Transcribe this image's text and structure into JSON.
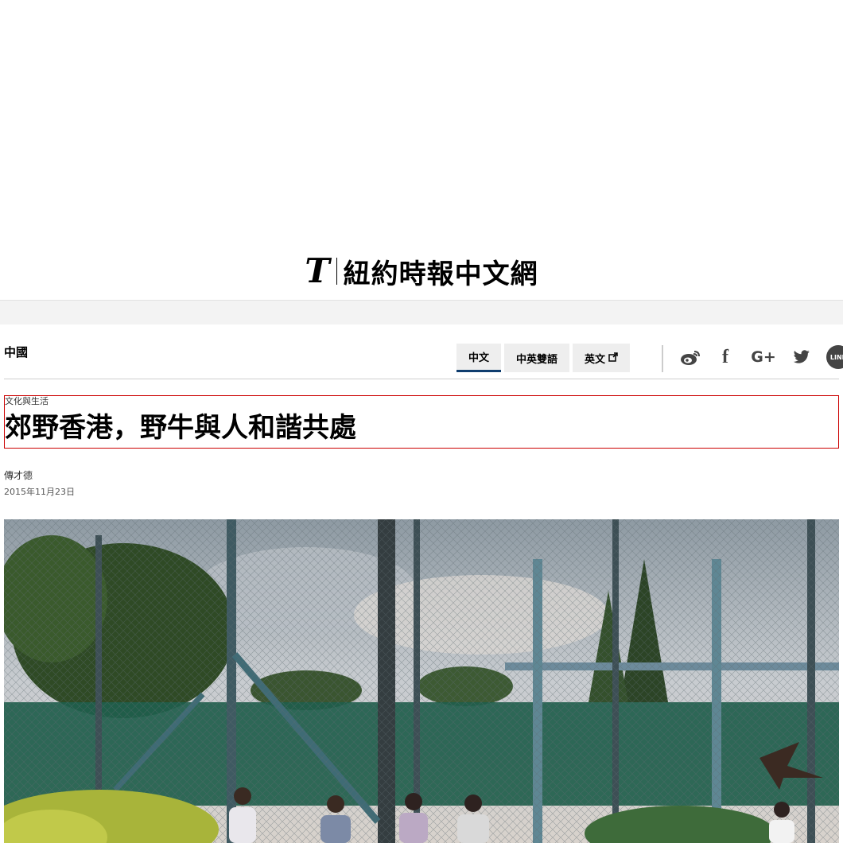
{
  "masthead": {
    "logo_letter": "T",
    "site_name": "紐約時報中文網"
  },
  "section": {
    "name": "中國"
  },
  "language_tabs": [
    {
      "label": "中文",
      "active": true
    },
    {
      "label": "中英雙語",
      "active": false
    },
    {
      "label": "英文",
      "active": false,
      "external": true
    }
  ],
  "share": {
    "icons": [
      "weibo-icon",
      "facebook-icon",
      "google-plus-icon",
      "twitter-icon",
      "line-icon"
    ],
    "weibo_glyph": "ꪭ",
    "facebook_glyph": "f",
    "gplus_glyph": "G+",
    "twitter_glyph": "🐦",
    "line_label": "LINE"
  },
  "article": {
    "kicker": "文化與生活",
    "headline": "郊野香港，野牛與人和諧共處",
    "byline": "傳才德",
    "date": "2015年11月23日"
  },
  "colors": {
    "active_tab_underline": "#0f3d6e",
    "headline_box_border": "#cc0000",
    "band_gray": "#f3f3f3"
  }
}
